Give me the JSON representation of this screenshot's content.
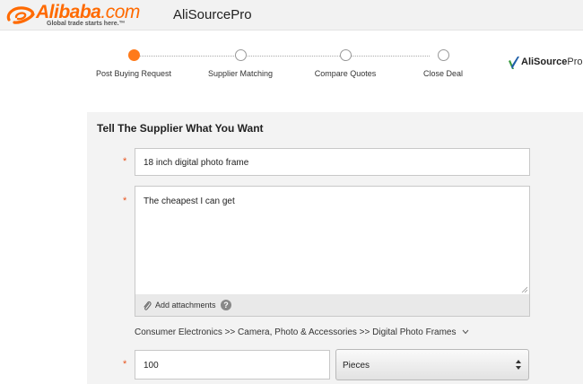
{
  "header": {
    "logo_word": "Alibaba",
    "logo_com": ".com",
    "logo_tagline": "Global trade starts here.™",
    "title": "AliSourcePro"
  },
  "steps": [
    {
      "label": "Post Buying Request",
      "active": true
    },
    {
      "label": "Supplier Matching",
      "active": false
    },
    {
      "label": "Compare Quotes",
      "active": false
    },
    {
      "label": "Close Deal",
      "active": false
    }
  ],
  "asp_logo": {
    "bold": "AliSource",
    "light": "Pro"
  },
  "form": {
    "title": "Tell The Supplier What You Want",
    "required_mark": "*",
    "product_name": "18 inch digital photo frame",
    "description": "The cheapest I can get",
    "attach_label": "Add attachments",
    "help_glyph": "?",
    "category_path": "Consumer Electronics >> Camera, Photo & Accessories >> Digital Photo Frames",
    "quantity": "100",
    "unit_selected": "Pieces"
  },
  "colors": {
    "accent": "#ff6a00",
    "active_step": "#ff7a1a",
    "required": "#e8541e"
  },
  "icons": {
    "logo": "alibaba-logo-icon",
    "attach": "paperclip-icon",
    "help": "help-icon",
    "category": "chevron-down-icon",
    "unit": "select-arrows-icon"
  }
}
